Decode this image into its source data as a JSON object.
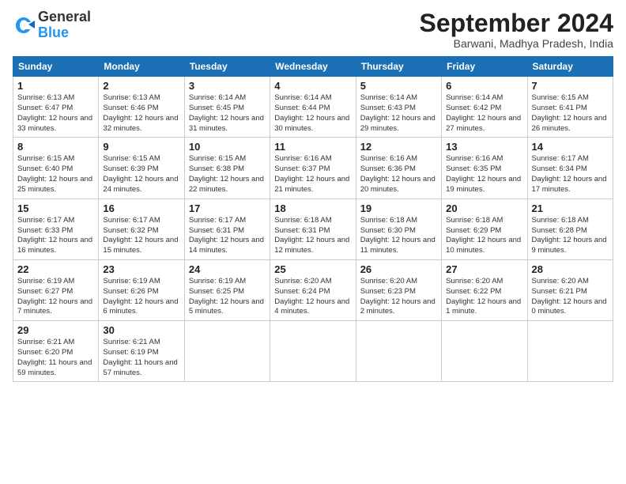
{
  "logo": {
    "general": "General",
    "blue": "Blue"
  },
  "title": "September 2024",
  "location": "Barwani, Madhya Pradesh, India",
  "headers": [
    "Sunday",
    "Monday",
    "Tuesday",
    "Wednesday",
    "Thursday",
    "Friday",
    "Saturday"
  ],
  "weeks": [
    [
      {
        "day": "1",
        "sunrise": "6:13 AM",
        "sunset": "6:47 PM",
        "daylight": "12 hours and 33 minutes."
      },
      {
        "day": "2",
        "sunrise": "6:13 AM",
        "sunset": "6:46 PM",
        "daylight": "12 hours and 32 minutes."
      },
      {
        "day": "3",
        "sunrise": "6:14 AM",
        "sunset": "6:45 PM",
        "daylight": "12 hours and 31 minutes."
      },
      {
        "day": "4",
        "sunrise": "6:14 AM",
        "sunset": "6:44 PM",
        "daylight": "12 hours and 30 minutes."
      },
      {
        "day": "5",
        "sunrise": "6:14 AM",
        "sunset": "6:43 PM",
        "daylight": "12 hours and 29 minutes."
      },
      {
        "day": "6",
        "sunrise": "6:14 AM",
        "sunset": "6:42 PM",
        "daylight": "12 hours and 27 minutes."
      },
      {
        "day": "7",
        "sunrise": "6:15 AM",
        "sunset": "6:41 PM",
        "daylight": "12 hours and 26 minutes."
      }
    ],
    [
      {
        "day": "8",
        "sunrise": "6:15 AM",
        "sunset": "6:40 PM",
        "daylight": "12 hours and 25 minutes."
      },
      {
        "day": "9",
        "sunrise": "6:15 AM",
        "sunset": "6:39 PM",
        "daylight": "12 hours and 24 minutes."
      },
      {
        "day": "10",
        "sunrise": "6:15 AM",
        "sunset": "6:38 PM",
        "daylight": "12 hours and 22 minutes."
      },
      {
        "day": "11",
        "sunrise": "6:16 AM",
        "sunset": "6:37 PM",
        "daylight": "12 hours and 21 minutes."
      },
      {
        "day": "12",
        "sunrise": "6:16 AM",
        "sunset": "6:36 PM",
        "daylight": "12 hours and 20 minutes."
      },
      {
        "day": "13",
        "sunrise": "6:16 AM",
        "sunset": "6:35 PM",
        "daylight": "12 hours and 19 minutes."
      },
      {
        "day": "14",
        "sunrise": "6:17 AM",
        "sunset": "6:34 PM",
        "daylight": "12 hours and 17 minutes."
      }
    ],
    [
      {
        "day": "15",
        "sunrise": "6:17 AM",
        "sunset": "6:33 PM",
        "daylight": "12 hours and 16 minutes."
      },
      {
        "day": "16",
        "sunrise": "6:17 AM",
        "sunset": "6:32 PM",
        "daylight": "12 hours and 15 minutes."
      },
      {
        "day": "17",
        "sunrise": "6:17 AM",
        "sunset": "6:31 PM",
        "daylight": "12 hours and 14 minutes."
      },
      {
        "day": "18",
        "sunrise": "6:18 AM",
        "sunset": "6:31 PM",
        "daylight": "12 hours and 12 minutes."
      },
      {
        "day": "19",
        "sunrise": "6:18 AM",
        "sunset": "6:30 PM",
        "daylight": "12 hours and 11 minutes."
      },
      {
        "day": "20",
        "sunrise": "6:18 AM",
        "sunset": "6:29 PM",
        "daylight": "12 hours and 10 minutes."
      },
      {
        "day": "21",
        "sunrise": "6:18 AM",
        "sunset": "6:28 PM",
        "daylight": "12 hours and 9 minutes."
      }
    ],
    [
      {
        "day": "22",
        "sunrise": "6:19 AM",
        "sunset": "6:27 PM",
        "daylight": "12 hours and 7 minutes."
      },
      {
        "day": "23",
        "sunrise": "6:19 AM",
        "sunset": "6:26 PM",
        "daylight": "12 hours and 6 minutes."
      },
      {
        "day": "24",
        "sunrise": "6:19 AM",
        "sunset": "6:25 PM",
        "daylight": "12 hours and 5 minutes."
      },
      {
        "day": "25",
        "sunrise": "6:20 AM",
        "sunset": "6:24 PM",
        "daylight": "12 hours and 4 minutes."
      },
      {
        "day": "26",
        "sunrise": "6:20 AM",
        "sunset": "6:23 PM",
        "daylight": "12 hours and 2 minutes."
      },
      {
        "day": "27",
        "sunrise": "6:20 AM",
        "sunset": "6:22 PM",
        "daylight": "12 hours and 1 minute."
      },
      {
        "day": "28",
        "sunrise": "6:20 AM",
        "sunset": "6:21 PM",
        "daylight": "12 hours and 0 minutes."
      }
    ],
    [
      {
        "day": "29",
        "sunrise": "6:21 AM",
        "sunset": "6:20 PM",
        "daylight": "11 hours and 59 minutes."
      },
      {
        "day": "30",
        "sunrise": "6:21 AM",
        "sunset": "6:19 PM",
        "daylight": "11 hours and 57 minutes."
      },
      null,
      null,
      null,
      null,
      null
    ]
  ]
}
